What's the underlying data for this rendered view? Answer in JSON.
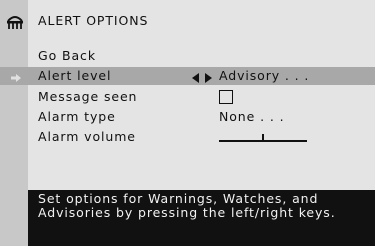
{
  "header": {
    "title": "ALERT OPTIONS",
    "icon": "siren-icon"
  },
  "menu": {
    "items": [
      {
        "label": "Go Back",
        "value": ""
      },
      {
        "label": "Alert level",
        "value": "Advisory . . .",
        "selected": true
      },
      {
        "label": "Message seen",
        "checked": false
      },
      {
        "label": "Alarm type",
        "value": "None . . ."
      },
      {
        "label": "Alarm volume",
        "level": 0.5
      }
    ]
  },
  "help": {
    "text": "Set options for Warnings, Watches, and Advisories by pressing the left/right keys."
  },
  "colors": {
    "background": "#e4e4e4",
    "left_strip": "#c8c8c8",
    "highlight": "#a8a8a8",
    "help_panel": "#111111",
    "help_text": "#f2f2f2"
  }
}
